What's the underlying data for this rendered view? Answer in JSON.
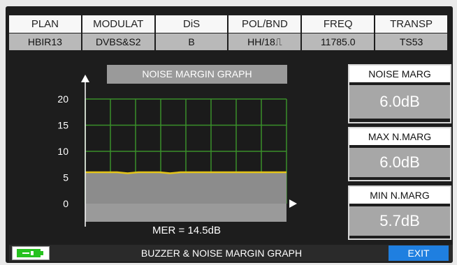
{
  "header": {
    "labels": [
      "PLAN",
      "MODULAT",
      "DiS",
      "POL/BND",
      "FREQ",
      "TRANSP"
    ],
    "values": [
      "HBIR13",
      "DVBS&S2",
      "B",
      "HH/18⎍",
      "11785.0",
      "TS53"
    ]
  },
  "graph": {
    "title": "NOISE MARGIN GRAPH",
    "mer_text": "MER = 14.5dB",
    "grid_color": "#3a8f2b",
    "trace_color": "#e4c417",
    "fill_color": "#8c8c8c"
  },
  "chart_data": {
    "type": "line",
    "title": "NOISE MARGIN GRAPH",
    "xlabel": "",
    "ylabel": "",
    "y_ticks": [
      "20",
      "15",
      "10",
      "5",
      "0"
    ],
    "ylim": [
      0,
      20
    ],
    "grid": true,
    "series": [
      {
        "values": [
          6.0,
          6.0,
          6.0,
          6.0,
          5.8,
          6.0,
          6.0,
          6.0,
          5.8,
          6.0,
          6.0,
          6.0,
          6.0,
          6.0,
          6.0,
          6.0,
          6.0,
          6.0,
          6.0,
          6.0
        ]
      }
    ]
  },
  "readouts": {
    "noise_marg_label": "NOISE MARG",
    "noise_marg_value": "6.0dB",
    "max_label": "MAX N.MARG",
    "max_value": "6.0dB",
    "min_label": "MIN N.MARG",
    "min_value": "5.7dB"
  },
  "status_bar": {
    "text": "BUZZER & NOISE MARGIN GRAPH",
    "exit_label": "EXIT",
    "battery_color": "#27c21f"
  }
}
